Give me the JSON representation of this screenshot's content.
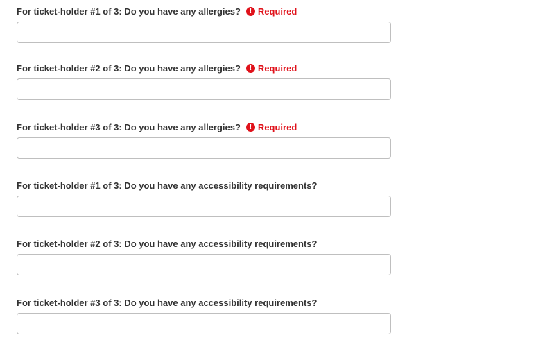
{
  "fields": [
    {
      "label": "For ticket-holder #1 of 3: Do you have any allergies?",
      "required": true,
      "required_label": "Required",
      "value": ""
    },
    {
      "label": "For ticket-holder #2 of 3: Do you have any allergies?",
      "required": true,
      "required_label": "Required",
      "value": ""
    },
    {
      "label": "For ticket-holder #3 of 3: Do you have any allergies?",
      "required": true,
      "required_label": "Required",
      "value": ""
    },
    {
      "label": "For ticket-holder #1 of 3: Do you have any accessibility requirements?",
      "required": false,
      "value": ""
    },
    {
      "label": "For ticket-holder #2 of 3: Do you have any accessibility requirements?",
      "required": false,
      "value": ""
    },
    {
      "label": "For ticket-holder #3 of 3: Do you have any accessibility requirements?",
      "required": false,
      "value": ""
    }
  ],
  "icons": {
    "required": "exclamation-circle-icon"
  },
  "colors": {
    "required": "#e0121b",
    "label": "#333333",
    "input_border": "#bfbfbf"
  }
}
